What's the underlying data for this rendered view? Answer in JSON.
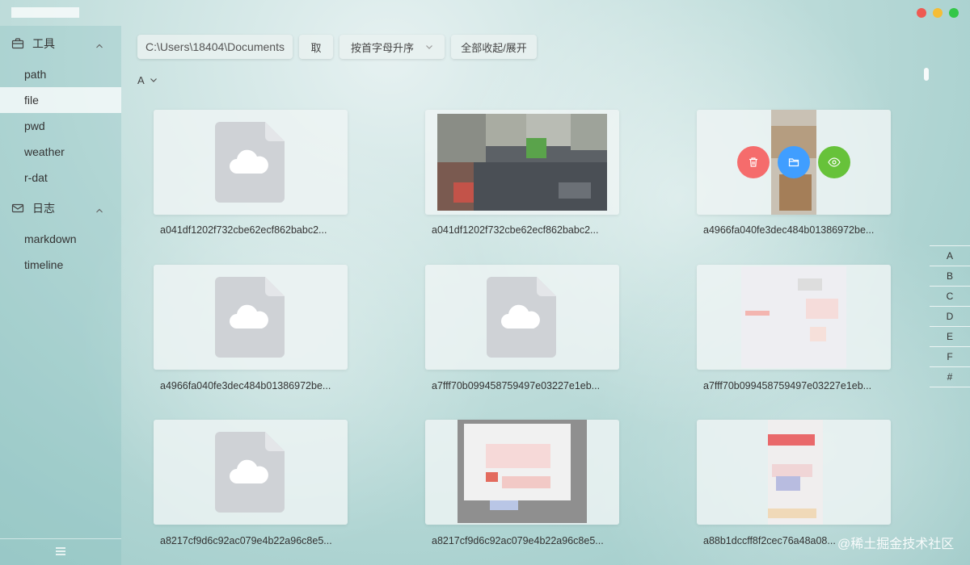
{
  "sidebar": {
    "groups": [
      {
        "label": "工具",
        "items": [
          "path",
          "file",
          "pwd",
          "weather",
          "r-dat"
        ]
      },
      {
        "label": "日志",
        "items": [
          "markdown",
          "timeline"
        ]
      }
    ],
    "active": "file"
  },
  "toolbar": {
    "path_value": "C:\\Users\\18404\\Documents",
    "fetch_label": "取",
    "sort_value": "按首字母升序",
    "toggle_label": "全部收起/展开"
  },
  "section": "A",
  "files": [
    {
      "name": "a041df1202f732cbe62ecf862babc2...",
      "type": "generic"
    },
    {
      "name": "a041df1202f732cbe62ecf862babc2...",
      "type": "image"
    },
    {
      "name": "a4966fa040fe3dec484b01386972be...",
      "type": "image",
      "hover": true
    },
    {
      "name": "a4966fa040fe3dec484b01386972be...",
      "type": "generic"
    },
    {
      "name": "a7fff70b099458759497e03227e1eb...",
      "type": "generic"
    },
    {
      "name": "a7fff70b099458759497e03227e1eb...",
      "type": "image"
    },
    {
      "name": "a8217cf9d6c92ac079e4b22a96c8e5...",
      "type": "generic"
    },
    {
      "name": "a8217cf9d6c92ac079e4b22a96c8e5...",
      "type": "image"
    },
    {
      "name": "a88b1dccff8f2cec76a48a08...",
      "type": "image"
    }
  ],
  "alphabet": [
    "A",
    "B",
    "C",
    "D",
    "E",
    "F",
    "#"
  ],
  "watermark": "@稀土掘金技术社区",
  "colors": {
    "delete": "#f56c6c",
    "open": "#409eff",
    "view": "#67c23a"
  }
}
